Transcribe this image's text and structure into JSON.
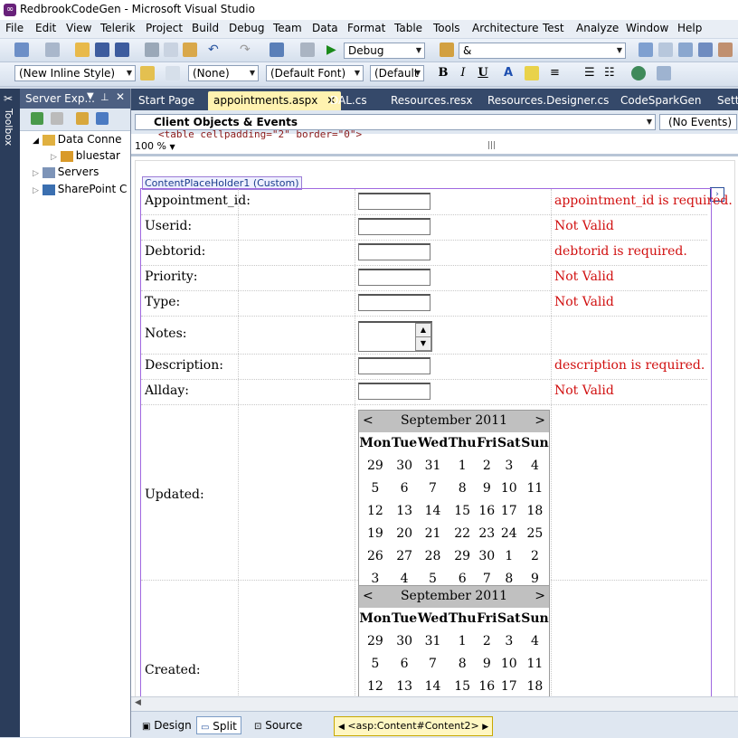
{
  "window": {
    "title": "RedbrookCodeGen - Microsoft Visual Studio"
  },
  "menu": [
    "File",
    "Edit",
    "View",
    "Telerik",
    "Project",
    "Build",
    "Debug",
    "Team",
    "Data",
    "Format",
    "Table",
    "Tools",
    "Architecture",
    "Test",
    "Analyze",
    "Window",
    "Help"
  ],
  "toolbar1": {
    "config": "Debug",
    "find": "&"
  },
  "toolbar2": {
    "style": "(New Inline Style)",
    "class": "(None)",
    "font": "(Default Font)",
    "size": "(Default"
  },
  "server_explorer": {
    "title": "Server Exp...",
    "nodes": [
      {
        "label": "Data Conne"
      },
      {
        "label": "bluestar"
      },
      {
        "label": "Servers"
      },
      {
        "label": "SharePoint C"
      }
    ]
  },
  "toolbox_label": "Toolbox",
  "tabs": [
    "Start Page",
    "appointments.aspx",
    "DAL.cs",
    "Resources.resx",
    "Resources.Designer.cs",
    "CodeSparkGen",
    "Sett"
  ],
  "editor": {
    "nav_left": "Client Objects & Events",
    "nav_right": "(No Events)",
    "source_line": "<table cellpadding=\"2\" border=\"0\">",
    "zoom": "100 %",
    "content_placeholder": "ContentPlaceHolder1 (Custom)"
  },
  "form": {
    "rows": [
      {
        "label": "Appointment_id:",
        "error": "appointment_id is required."
      },
      {
        "label": "Userid:",
        "error": "Not Valid"
      },
      {
        "label": "Debtorid:",
        "error": "debtorid is required."
      },
      {
        "label": "Priority:",
        "error": "Not Valid"
      },
      {
        "label": "Type:",
        "error": "Not Valid"
      },
      {
        "label": "Notes:",
        "error": ""
      },
      {
        "label": "Description:",
        "error": "description is required."
      },
      {
        "label": "Allday:",
        "error": "Not Valid"
      }
    ],
    "updated_label": "Updated:",
    "created_label": "Created:"
  },
  "calendar": {
    "month": "September 2011",
    "prev": "<",
    "next": ">",
    "days": [
      "Mon",
      "Tue",
      "Wed",
      "Thu",
      "Fri",
      "Sat",
      "Sun"
    ],
    "weeks": [
      [
        "29",
        "30",
        "31",
        "1",
        "2",
        "3",
        "4"
      ],
      [
        "5",
        "6",
        "7",
        "8",
        "9",
        "10",
        "11"
      ],
      [
        "12",
        "13",
        "14",
        "15",
        "16",
        "17",
        "18"
      ],
      [
        "19",
        "20",
        "21",
        "22",
        "23",
        "24",
        "25"
      ],
      [
        "26",
        "27",
        "28",
        "29",
        "30",
        "1",
        "2"
      ],
      [
        "3",
        "4",
        "5",
        "6",
        "7",
        "8",
        "9"
      ]
    ]
  },
  "bottom": {
    "design": "Design",
    "split": "Split",
    "source": "Source",
    "breadcrumb": "<asp:Content#Content2>"
  }
}
